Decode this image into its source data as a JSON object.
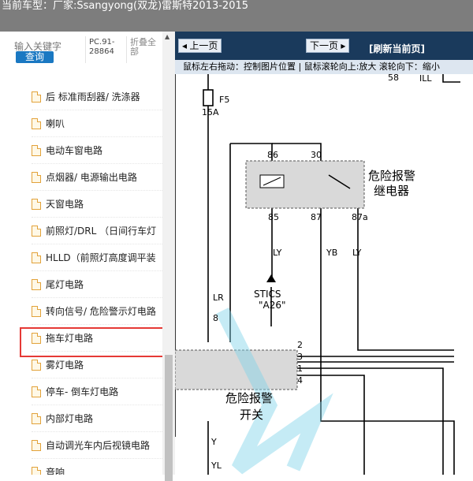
{
  "header": {
    "label": "当前车型：",
    "vehicle": "厂家:Ssangyong(双龙)雷斯特2013-2015"
  },
  "sidebar": {
    "search_placeholder": "输入关键字",
    "search_button": "查询",
    "pc_code": "PC.91-28864",
    "collapse_all": "折叠全部",
    "items": [
      {
        "label": "后 标准雨刮器/ 洗涤器"
      },
      {
        "label": "喇叭"
      },
      {
        "label": "电动车窗电路"
      },
      {
        "label": "点烟器/ 电源输出电路"
      },
      {
        "label": "天窗电路"
      },
      {
        "label": "前照灯/DRL （日间行车灯"
      },
      {
        "label": "HLLD（前照灯高度调平装"
      },
      {
        "label": "尾灯电路"
      },
      {
        "label": "转向信号/ 危险警示灯电路"
      },
      {
        "label": "拖车灯电路"
      },
      {
        "label": "雾灯电路"
      },
      {
        "label": "停车- 倒车灯电路"
      },
      {
        "label": "内部灯电路"
      },
      {
        "label": "自动调光车内后视镜电路"
      },
      {
        "label": "音响"
      }
    ],
    "selected_index": 8
  },
  "viewer": {
    "prev_button": "上一页",
    "next_button": "下一页",
    "refresh": "[刷新当前页]",
    "hint": "鼠标左右拖动：控制图片位置 | 鼠标滚轮向上:放大  滚轮向下：缩小"
  },
  "diagram": {
    "fuse_label": "F5",
    "fuse_rating": "15A",
    "top_wire": "58",
    "top_tag": "ILL",
    "relay_pins": [
      "86",
      "30",
      "85",
      "87",
      "87a"
    ],
    "relay_name_line1": "危险报警",
    "relay_name_line2": "继电器",
    "wire_colors": [
      "LY",
      "YB",
      "LY"
    ],
    "ground_label1": "STICS",
    "ground_label2": "\"A26\"",
    "lr_label": "LR",
    "lr_pin": "8",
    "switch_pins": [
      "2",
      "3",
      "1",
      "4"
    ],
    "switch_name_line1": "危险报警",
    "switch_name_line2": "开关",
    "bottom_wires": [
      "Y",
      "YL"
    ]
  }
}
